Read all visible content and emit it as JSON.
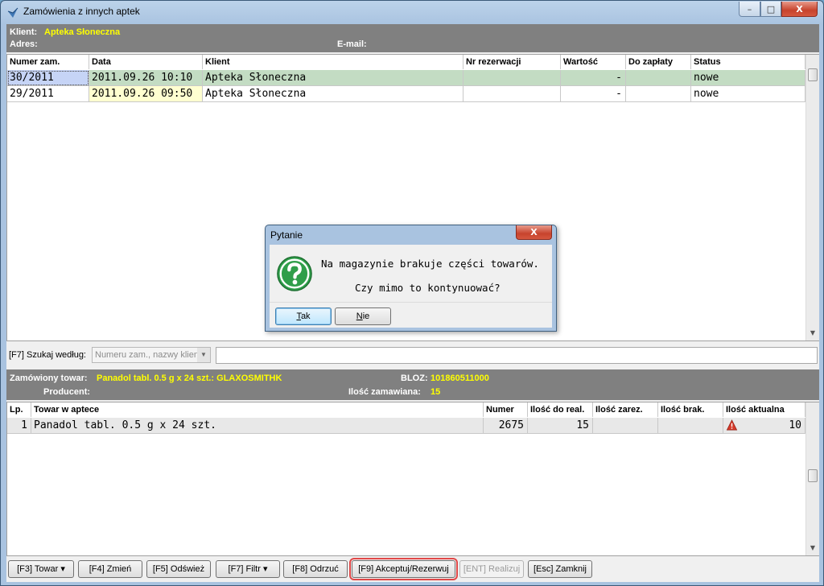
{
  "window": {
    "title": "Zamówienia z innych aptek",
    "min": "–",
    "max": "□",
    "close": "X"
  },
  "client_info": {
    "client_label": "Klient:",
    "client_value": "Apteka Słoneczna",
    "address_label": "Adres:",
    "email_label": "E-mail:"
  },
  "orders": {
    "columns": [
      "Numer zam.",
      "Data",
      "Klient",
      "Nr rezerwacji",
      "Wartość",
      "Do zapłaty",
      "Status"
    ],
    "rows": [
      {
        "numer": "30/2011",
        "data": "2011.09.26 10:10",
        "klient": "Apteka Słoneczna",
        "nr_rez": "",
        "wartosc": "-",
        "do_zaplaty": "",
        "status": "nowe"
      },
      {
        "numer": "29/2011",
        "data": "2011.09.26 09:50",
        "klient": "Apteka Słoneczna",
        "nr_rez": "",
        "wartosc": "-",
        "do_zaplaty": "",
        "status": "nowe"
      }
    ]
  },
  "search": {
    "label": "[F7] Szukaj według:",
    "combo_value": "Numeru zam., nazwy klient",
    "query": ""
  },
  "item_info": {
    "ordered_label": "Zamówiony towar:",
    "ordered_value": "Panadol tabl. 0.5 g x 24 szt.: GLAXOSMITHK",
    "producer_label": "Producent:",
    "bloz_label": "BLOZ:",
    "bloz_value": "101860511000",
    "qty_label": "Ilość zamawiana:",
    "qty_value": "15"
  },
  "items": {
    "columns": [
      "Lp.",
      "Towar w aptece",
      "Numer",
      "Ilość do real.",
      "Ilość zarez.",
      "Ilość brak.",
      "Ilość aktualna"
    ],
    "rows": [
      {
        "lp": "1",
        "towar": "Panadol tabl. 0.5 g x 24 szt.",
        "numer": "2675",
        "do_real": "15",
        "zarez": "",
        "brak": "",
        "aktualna": "10"
      }
    ]
  },
  "buttons": {
    "towar": "[F3] Towar",
    "zmien": "[F4] Zmień",
    "odswiez": "[F5] Odśwież",
    "filtr": "[F7] Filtr",
    "odrzuc": "[F8] Odrzuć",
    "akceptuj": "[F9] Akceptuj/Rezerwuj",
    "realizuj": "[ENT] Realizuj",
    "zamknij": "[Esc] Zamknij"
  },
  "dialog": {
    "title": "Pytanie",
    "close": "X",
    "line1": "Na magazynie brakuje części towarów.",
    "line2": "Czy mimo to kontynuować?",
    "yes_u": "T",
    "yes_rest": "ak",
    "no_u": "N",
    "no_rest": "ie"
  },
  "colors": {
    "selected_row": "#c3dcc3",
    "warning": "#d63a2a",
    "info_bar": "#808080",
    "highlight": "#ffff00"
  }
}
